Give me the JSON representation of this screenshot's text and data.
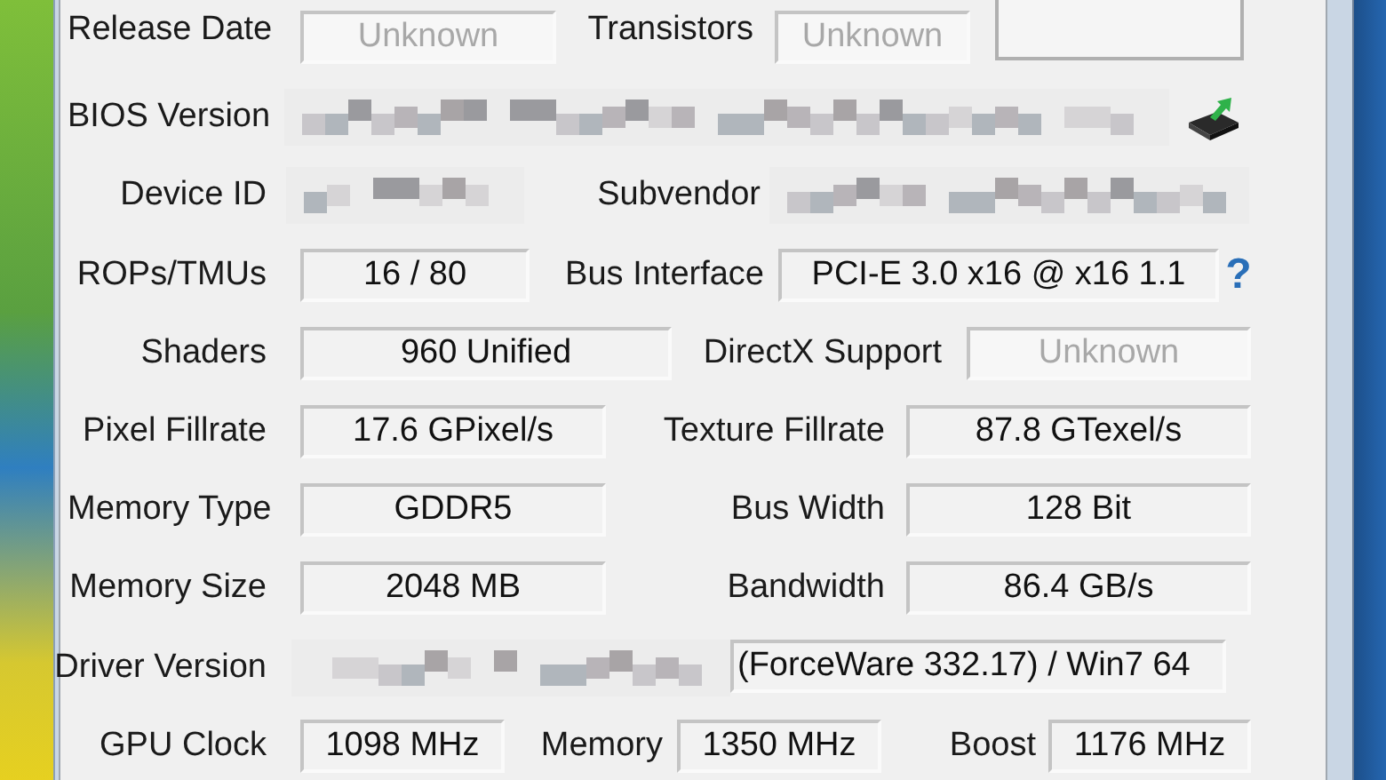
{
  "rows": [
    {
      "cells": [
        {
          "kind": "label",
          "text": "Release Date"
        },
        {
          "kind": "field",
          "text": "Unknown",
          "disabled": true
        },
        {
          "kind": "label",
          "text": "Transistors"
        },
        {
          "kind": "field",
          "text": "Unknown",
          "disabled": true
        },
        {
          "kind": "panel"
        }
      ]
    },
    {
      "cells": [
        {
          "kind": "label",
          "text": "BIOS Version"
        },
        {
          "kind": "redacted"
        },
        {
          "kind": "bios_icon"
        }
      ]
    },
    {
      "cells": [
        {
          "kind": "label",
          "text": "Device ID"
        },
        {
          "kind": "redacted"
        },
        {
          "kind": "label",
          "text": "Subvendor"
        },
        {
          "kind": "redacted"
        }
      ]
    },
    {
      "cells": [
        {
          "kind": "label",
          "text": "ROPs/TMUs"
        },
        {
          "kind": "field",
          "text": "16 / 80",
          "disabled": false
        },
        {
          "kind": "label",
          "text": "Bus Interface"
        },
        {
          "kind": "field",
          "text": "PCI-E 3.0 x16 @ x16 1.1",
          "disabled": false
        },
        {
          "kind": "help",
          "text": "?"
        }
      ]
    },
    {
      "cells": [
        {
          "kind": "label",
          "text": "Shaders"
        },
        {
          "kind": "field",
          "text": "960 Unified",
          "disabled": false
        },
        {
          "kind": "label",
          "text": "DirectX Support"
        },
        {
          "kind": "field",
          "text": "Unknown",
          "disabled": true
        }
      ]
    },
    {
      "cells": [
        {
          "kind": "label",
          "text": "Pixel Fillrate"
        },
        {
          "kind": "field",
          "text": "17.6 GPixel/s",
          "disabled": false
        },
        {
          "kind": "label",
          "text": "Texture Fillrate"
        },
        {
          "kind": "field",
          "text": "87.8 GTexel/s",
          "disabled": false
        }
      ]
    },
    {
      "cells": [
        {
          "kind": "label",
          "text": "Memory Type"
        },
        {
          "kind": "field",
          "text": "GDDR5",
          "disabled": false
        },
        {
          "kind": "label",
          "text": "Bus Width"
        },
        {
          "kind": "field",
          "text": "128 Bit",
          "disabled": false
        }
      ]
    },
    {
      "cells": [
        {
          "kind": "label",
          "text": "Memory Size"
        },
        {
          "kind": "field",
          "text": "2048 MB",
          "disabled": false
        },
        {
          "kind": "label",
          "text": "Bandwidth"
        },
        {
          "kind": "field",
          "text": "86.4 GB/s",
          "disabled": false
        }
      ]
    },
    {
      "cells": [
        {
          "kind": "label",
          "text": "Driver Version"
        },
        {
          "kind": "partly_redacted",
          "text": "(ForceWare 332.17) / Win7 64"
        }
      ]
    },
    {
      "cells": [
        {
          "kind": "label",
          "text": "GPU Clock"
        },
        {
          "kind": "field",
          "text": "1098 MHz",
          "disabled": false
        },
        {
          "kind": "label",
          "text": "Memory"
        },
        {
          "kind": "field",
          "text": "1350 MHz",
          "disabled": false
        },
        {
          "kind": "label",
          "text": "Boost"
        },
        {
          "kind": "field",
          "text": "1176 MHz",
          "disabled": false
        }
      ]
    }
  ]
}
